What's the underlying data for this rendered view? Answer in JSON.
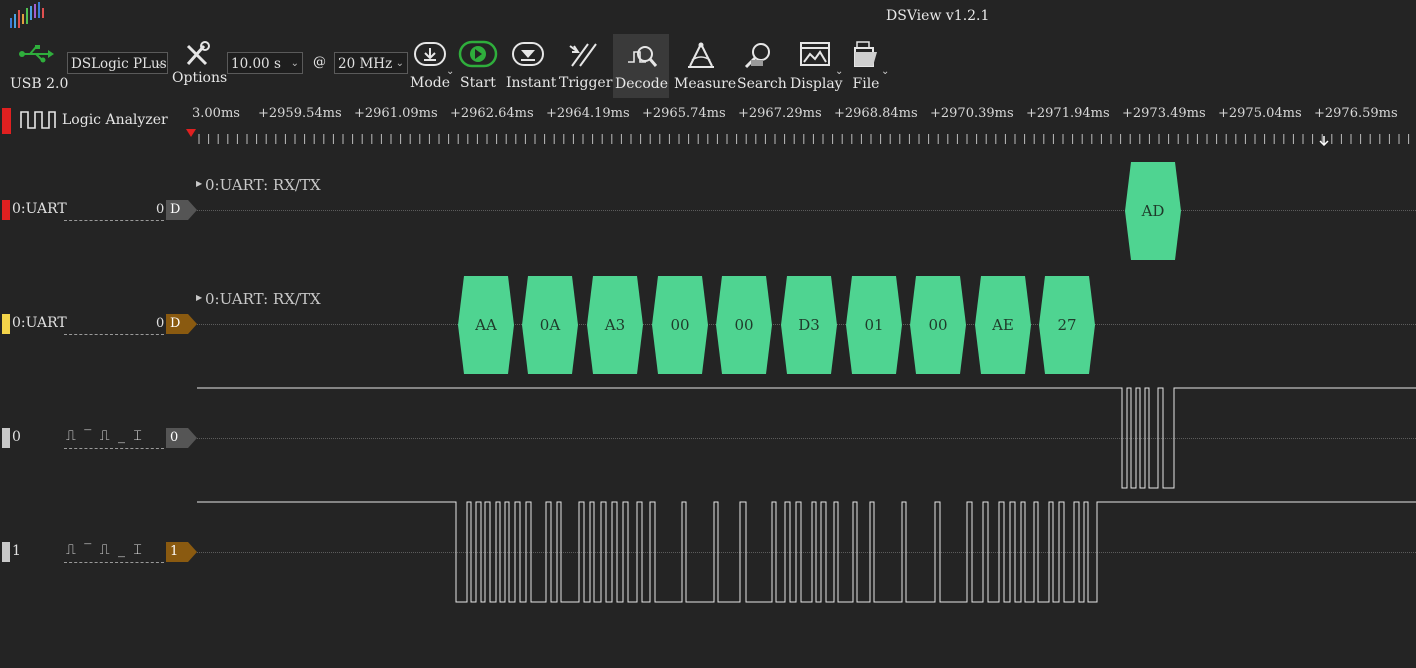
{
  "window": {
    "title": "DSView v1.2.1"
  },
  "toolbar": {
    "usb_label": "USB 2.0",
    "device": "DSLogic PLus",
    "options_label": "Options",
    "duration": "10.00 s",
    "at_symbol": "@",
    "samplerate": "20 MHz",
    "buttons": {
      "mode": "Mode",
      "start": "Start",
      "instant": "Instant",
      "trigger": "Trigger",
      "decode": "Decode",
      "measure": "Measure",
      "search": "Search",
      "display": "Display",
      "file": "File"
    }
  },
  "ruler": {
    "panel_label": "Logic Analyzer",
    "ticks": [
      "3.00ms",
      "+2959.54ms",
      "+2961.09ms",
      "+2962.64ms",
      "+2964.19ms",
      "+2965.74ms",
      "+2967.29ms",
      "+2968.84ms",
      "+2970.39ms",
      "+2971.94ms",
      "+2973.49ms",
      "+2975.04ms",
      "+2976.59ms"
    ]
  },
  "channels": [
    {
      "name": "0:UART",
      "value": "0",
      "tag": "D",
      "color": "#e02020",
      "decoder_title": "0:UART: RX/TX",
      "bytes": [
        "AD"
      ]
    },
    {
      "name": "0:UART",
      "value": "0",
      "tag": "D",
      "color": "#f3d44a",
      "decoder_title": "0:UART: RX/TX",
      "bytes": [
        "AA",
        "0A",
        "A3",
        "00",
        "00",
        "D3",
        "01",
        "00",
        "AE",
        "27"
      ]
    },
    {
      "name": "0",
      "tag": "0",
      "color": "#c8c8c8",
      "trigger_symbols": "⎍ ‾ ⎍ _ ⌶"
    },
    {
      "name": "1",
      "tag": "1",
      "color": "#c8c8c8",
      "trigger_symbols": "⎍ ‾ ⎍ _ ⌶"
    }
  ],
  "colors": {
    "decode_cell": "#4fd491",
    "tag_decoder0": "#555555",
    "tag_decoder1": "#8a5a10",
    "tag_ch0": "#555555",
    "tag_ch1": "#8a5a10",
    "accent_green": "#2fae3c"
  }
}
